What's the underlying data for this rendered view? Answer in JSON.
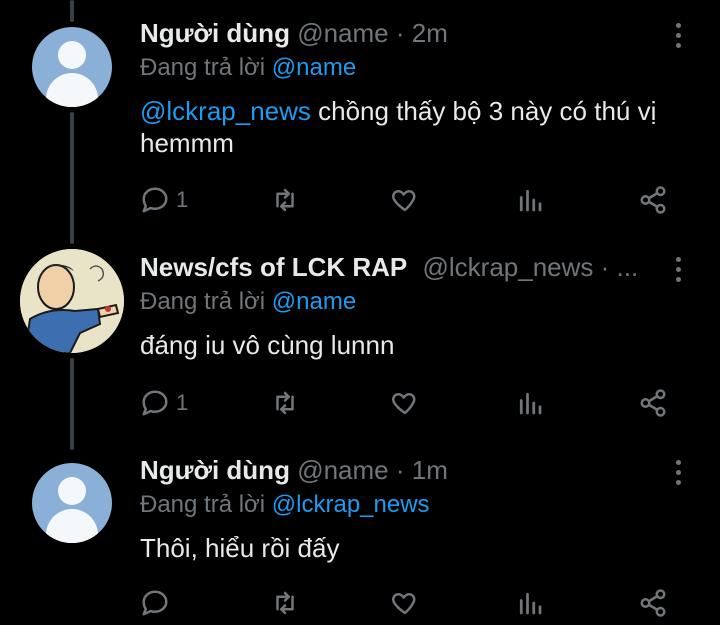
{
  "tweets": [
    {
      "name": "Người dùng",
      "handle": "@name",
      "time": "· 2m",
      "reply_prefix": "Đang trả lời",
      "reply_to": "@name",
      "mention": "@lckrap_news",
      "text": " chồng thấy bộ 3 này có thú vị hemmm",
      "reply_count": "1",
      "avatar": "default-avatar"
    },
    {
      "name": "News/cfs of LCK RAP",
      "handle": "@lckrap_news",
      "time": "· ...",
      "reply_prefix": "Đang trả lời",
      "reply_to": "@name",
      "text": "đáng iu vô cùng lunnn",
      "reply_count": "1",
      "avatar": "drawn-character-avatar"
    },
    {
      "name": "Người dùng",
      "handle": "@name",
      "time": "· 1m",
      "reply_prefix": "Đang trả lời",
      "reply_to": "@lckrap_news",
      "text": "Thôi, hiểu rồi đấy",
      "reply_count": "",
      "avatar": "default-avatar"
    }
  ],
  "icons": [
    "reply-icon",
    "retweet-icon",
    "like-icon",
    "analytics-icon",
    "share-icon",
    "more-options-icon"
  ],
  "colors": {
    "background": "#000000",
    "text": "#e7e9ea",
    "muted": "#71767b",
    "accent": "#1d9bf0"
  }
}
